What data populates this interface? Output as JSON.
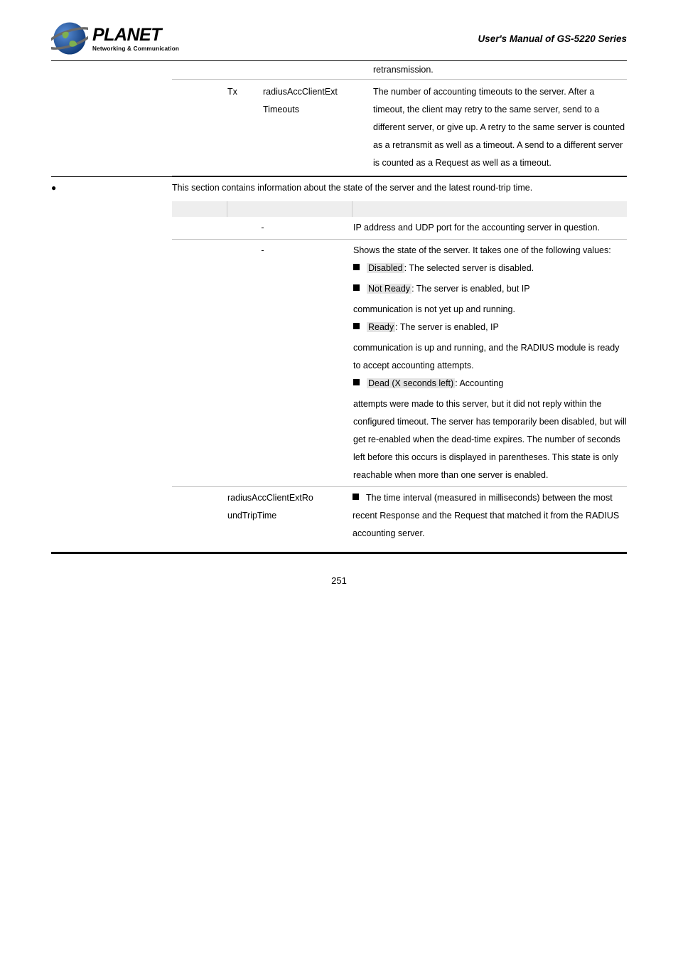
{
  "header": {
    "brand": "PLANET",
    "tagline": "Networking & Communication",
    "manual_title": "User's Manual of GS-5220 Series"
  },
  "row1": {
    "retrans": "retransmission.",
    "tx": "Tx",
    "mib": "radiusAccClientExt Timeouts",
    "desc": "The number of accounting timeouts to the server. After a timeout, the client may retry to the same server, send to a different server, or give up. A retry to the same server is counted as a retransmit as well as a timeout. A send to a different server is counted as a Request as well as a timeout."
  },
  "section2": {
    "intro": "This section contains information about the state of the server and the latest round-trip time.",
    "ip": {
      "desc": "IP address and UDP port for the accounting server in question."
    },
    "state": {
      "intro": "Shows the state of the server. It takes one of the following values:",
      "disabled_lbl": "Disabled",
      "disabled_txt": ": The selected server is disabled.",
      "notready_lbl": "Not Ready",
      "notready_txt_a": ": The server is enabled, but IP",
      "notready_txt_b": "communication is not yet up and running.",
      "ready_lbl": "Ready",
      "ready_txt_a": ": The server is enabled, IP",
      "ready_txt_b": "communication is up and running, and the RADIUS module is ready to accept accounting attempts.",
      "dead_lbl": "Dead (X seconds left)",
      "dead_txt_a": ": Accounting",
      "dead_txt_b": "attempts were made to this server, but it did not reply within the configured timeout. The server has temporarily been disabled, but will get re-enabled when the dead-time expires. The number of seconds left before this occurs is displayed in parentheses. This state is only reachable when more than one server is enabled."
    },
    "rtt": {
      "mib": "radiusAccClientExtRoundTripTime",
      "desc": "The time interval (measured in milliseconds) between the most recent Response and the Request that matched it from the RADIUS accounting server."
    }
  },
  "page_number": "251"
}
